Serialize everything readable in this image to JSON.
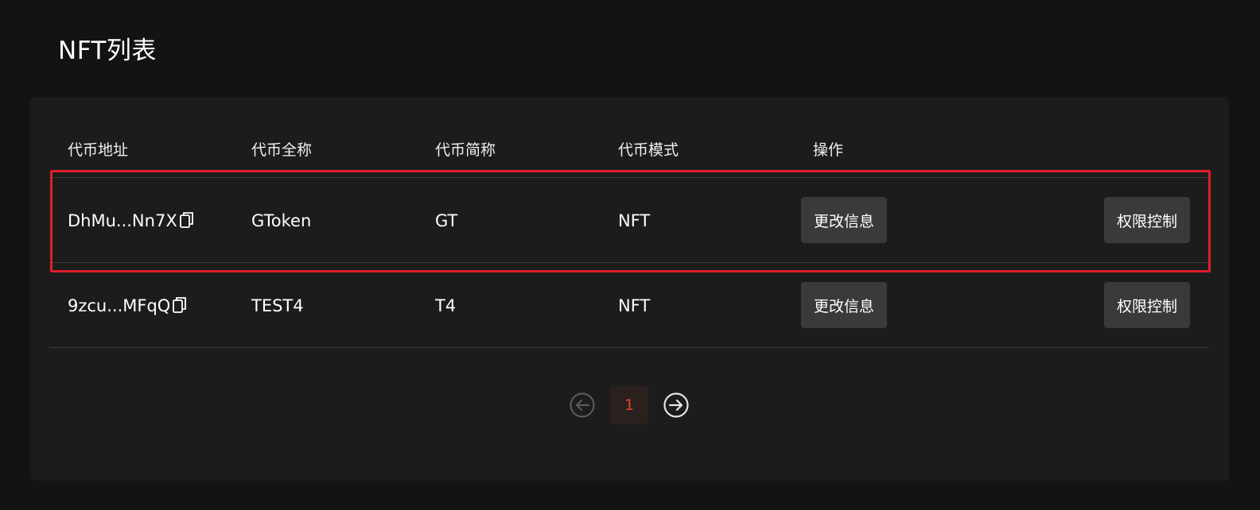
{
  "page": {
    "title": "NFT列表"
  },
  "table": {
    "headers": [
      "代币地址",
      "代币全称",
      "代币简称",
      "代币模式",
      "操作"
    ],
    "rows": [
      {
        "address": "DhMu...Nn7X",
        "full_name": "GToken",
        "symbol": "GT",
        "mode": "NFT",
        "edit_label": "更改信息",
        "perm_label": "权限控制"
      },
      {
        "address": "9zcu...MFqQ",
        "full_name": "TEST4",
        "symbol": "T4",
        "mode": "NFT",
        "edit_label": "更改信息",
        "perm_label": "权限控制"
      }
    ]
  },
  "pagination": {
    "current": "1",
    "prev_icon": "arrow-left-circle-icon",
    "next_icon": "arrow-right-circle-icon"
  },
  "colors": {
    "background": "#131313",
    "card": "#1c1c1c",
    "button": "#3a3a3a",
    "accent": "#e0432b",
    "highlight": "#e21d2b"
  }
}
